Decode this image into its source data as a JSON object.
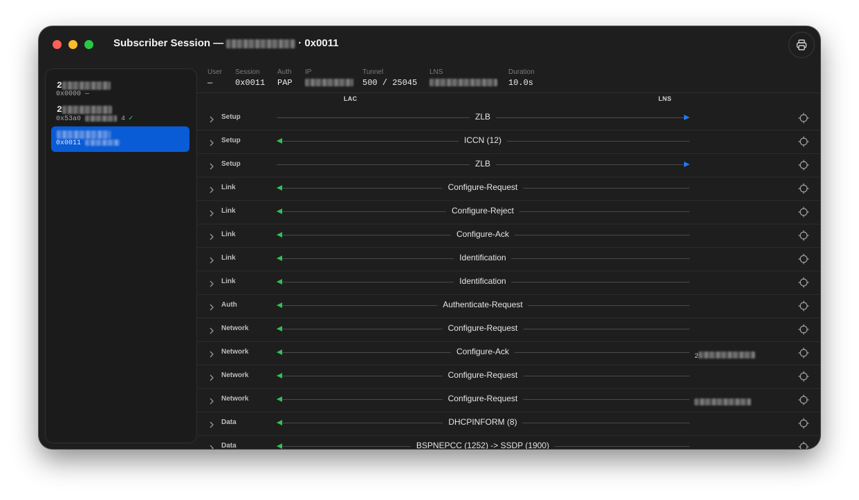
{
  "window": {
    "title_prefix": "Subscriber Session —",
    "title_suffix": "· 0x0011"
  },
  "sidebar": {
    "sessions": [
      {
        "name": "2",
        "id": "0x0000",
        "extra": "—",
        "selected": false,
        "verified": false
      },
      {
        "name": "2",
        "id": "0x53a0",
        "extra": "4",
        "selected": false,
        "verified": true
      },
      {
        "name": "",
        "id": "0x0011",
        "extra": "",
        "selected": true,
        "verified": false
      }
    ]
  },
  "info": {
    "user_label": "User",
    "user_value": "—",
    "session_label": "Session",
    "session_value": "0x0011",
    "auth_label": "Auth",
    "auth_value": "PAP",
    "ip_label": "IP",
    "tunnel_label": "Tunnel",
    "tunnel_value": "500 / 25045",
    "lns_label": "LNS",
    "duration_label": "Duration",
    "duration_value": "10.0s"
  },
  "columns": {
    "lac": "LAC",
    "lns": "LNS"
  },
  "messages": [
    {
      "category": "Setup",
      "name": "ZLB",
      "direction": "right",
      "note": ""
    },
    {
      "category": "Setup",
      "name": "ICCN (12)",
      "direction": "left",
      "note": ""
    },
    {
      "category": "Setup",
      "name": "ZLB",
      "direction": "right",
      "note": ""
    },
    {
      "category": "Link",
      "name": "Configure-Request",
      "direction": "left",
      "note": ""
    },
    {
      "category": "Link",
      "name": "Configure-Reject",
      "direction": "left",
      "note": ""
    },
    {
      "category": "Link",
      "name": "Configure-Ack",
      "direction": "left",
      "note": ""
    },
    {
      "category": "Link",
      "name": "Identification",
      "direction": "left",
      "note": ""
    },
    {
      "category": "Link",
      "name": "Identification",
      "direction": "left",
      "note": ""
    },
    {
      "category": "Auth",
      "name": "Authenticate-Request",
      "direction": "left",
      "note": ""
    },
    {
      "category": "Network",
      "name": "Configure-Request",
      "direction": "left",
      "note": ""
    },
    {
      "category": "Network",
      "name": "Configure-Ack",
      "direction": "left",
      "note": "2"
    },
    {
      "category": "Network",
      "name": "Configure-Request",
      "direction": "left",
      "note": ""
    },
    {
      "category": "Network",
      "name": "Configure-Request",
      "direction": "left",
      "note": ""
    },
    {
      "category": "Data",
      "name": "DHCPINFORM (8)",
      "direction": "left",
      "note": ""
    },
    {
      "category": "Data",
      "name": "BSPNEPCC (1252) -> SSDP (1900)",
      "direction": "left",
      "note": ""
    }
  ],
  "colors": {
    "window_bg": "#1e1e1e",
    "selected_bg": "#0a5bd6",
    "arrow_in": "#2ec455",
    "arrow_out": "#1c7ef5"
  },
  "icons": {
    "print": "printer-icon",
    "expand": "chevron-right-icon",
    "locate": "crosshair-icon",
    "verified": "checkmark-icon"
  }
}
